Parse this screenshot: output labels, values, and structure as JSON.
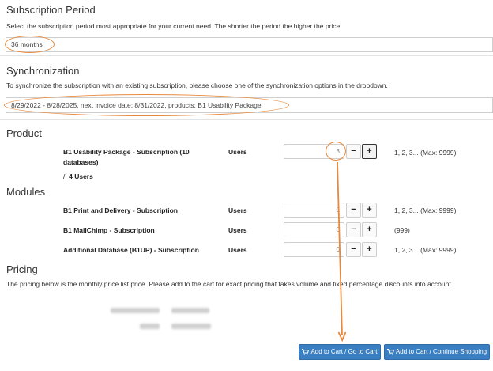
{
  "subscription_period": {
    "heading": "Subscription Period",
    "description": "Select the subscription period most appropriate for your current need. The shorter the period the higher the price.",
    "selected": "36 months"
  },
  "synchronization": {
    "heading": "Synchronization",
    "description": "To synchronize the subscription with an existing subscription, please choose one of the synchronization options in the dropdown.",
    "selected": "8/29/2022 - 8/28/2025, next invoice date: 8/31/2022, products: B1 Usability Package"
  },
  "product": {
    "heading": "Product",
    "name_line1": "B1 Usability Package - Subscription (10",
    "name_line2": "databases)",
    "unit": "Users",
    "quantity": "3",
    "hint": "1, 2, 3... (Max: 9999)",
    "sub_sep": "/",
    "sub_value": "4 Users"
  },
  "modules": {
    "heading": "Modules",
    "items": [
      {
        "name": "B1 Print and Delivery - Subscription",
        "unit": "Users",
        "quantity": "0",
        "hint": "1, 2, 3... (Max: 9999)"
      },
      {
        "name": "B1 MailChimp - Subscription",
        "unit": "Users",
        "quantity": "0",
        "hint": "(999)"
      },
      {
        "name": "Additional Database (B1UP) - Subscription",
        "unit": "Users",
        "quantity": "0",
        "hint": "1, 2, 3... (Max: 9999)"
      }
    ]
  },
  "pricing": {
    "heading": "Pricing",
    "description": "The pricing below is the monthly price list price. Please add to the cart for exact pricing that takes volume and fixed percentage discounts into account."
  },
  "stepper": {
    "minus": "−",
    "plus": "+"
  },
  "buttons": {
    "add_go_cart": "Add to Cart / Go to Cart",
    "add_continue": "Add to Cart / Continue Shopping"
  },
  "colors": {
    "annotation": "#e8883a",
    "button_blue": "#3a7fc1"
  }
}
